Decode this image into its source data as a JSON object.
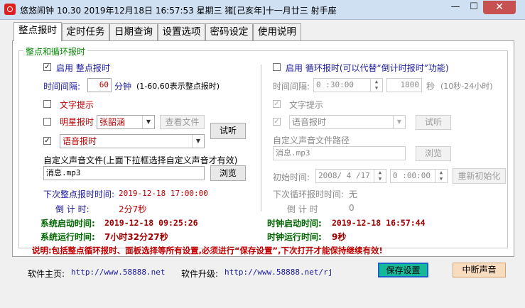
{
  "window": {
    "title": "悠悠闹钟 10.30 2019年12月18日 16:57:53 星期三 猪[己亥年]十一月廿三 射手座",
    "min_glyph": "—",
    "max_glyph": "☐",
    "close_glyph": "✕"
  },
  "tabs": [
    "整点报时",
    "定时任务",
    "日期查询",
    "设置选项",
    "密码设定",
    "使用说明"
  ],
  "group_title": "整点和循环报时",
  "left": {
    "enable_label": "启用 整点报时",
    "interval_label": "时间间隔:",
    "interval_value": "60",
    "interval_unit": "分钟",
    "interval_hint": "(1-60,60表示整点报时)",
    "text_prompt": "文字提示",
    "star_label": "明星报时",
    "star_select": "张韶涵",
    "view_file_btn": "查看文件",
    "audition_btn": "试听",
    "voice_select": "语音报时",
    "custom_sound_label": "自定义声音文件(上面下拉框选择自定义声音才有效)",
    "custom_file": "消息.mp3",
    "browse_btn": "浏览",
    "next_label": "下次整点报时时间:",
    "next_time": "2019-12-18 17:00:00",
    "countdown_label": "倒 计 时:",
    "countdown_value": "2分7秒",
    "sys_start_label": "系统启动时间:",
    "sys_start_value": "2019-12-18 09:25:26",
    "sys_run_label": "系统运行时间:",
    "sys_run_value": "7小时32分27秒"
  },
  "right": {
    "enable_label": "启用 循环报时(可以代替“倒计时报时”功能)",
    "interval_label": "时间间隔:",
    "interval_time": "0 :30:00",
    "interval_seconds": "1800",
    "sec_unit": "秒",
    "sec_hint": "(10秒-24小时)",
    "text_prompt": "文字提示",
    "voice_select": "语音报时",
    "audition_btn": "试听",
    "custom_path_label": "自定义声音文件路径",
    "custom_file": "消息.mp3",
    "browse_btn": "浏览",
    "init_label": "初始时间:",
    "init_date": "2008/ 4 /17",
    "init_time": "0 :00:00",
    "reinit_btn": "重新初始化",
    "next_label": "下次循环报时时间:",
    "next_value": "无",
    "countdown_label": "倒 计 时",
    "countdown_value": "0",
    "clock_start_label": "时钟启动时间:",
    "clock_start_value": "2019-12-18 16:57:44",
    "clock_run_label": "时钟运行时间:",
    "clock_run_value": "9秒"
  },
  "notice": "说明:包括整点循环报时、面板选择等所有设置,必须进行“保存设置”,下次打开才能保持继续有效!",
  "footer": {
    "home_label": "软件主页:",
    "home_url": "http://www.58888.net",
    "upgrade_label": "软件升级:",
    "upgrade_url": "http://www.58888.net/rj",
    "save_btn": "保存设置",
    "stop_btn": "中断声音"
  },
  "colors": {
    "accent_green": "#008800",
    "red": "#c00000",
    "blue": "#1a1aa0"
  }
}
